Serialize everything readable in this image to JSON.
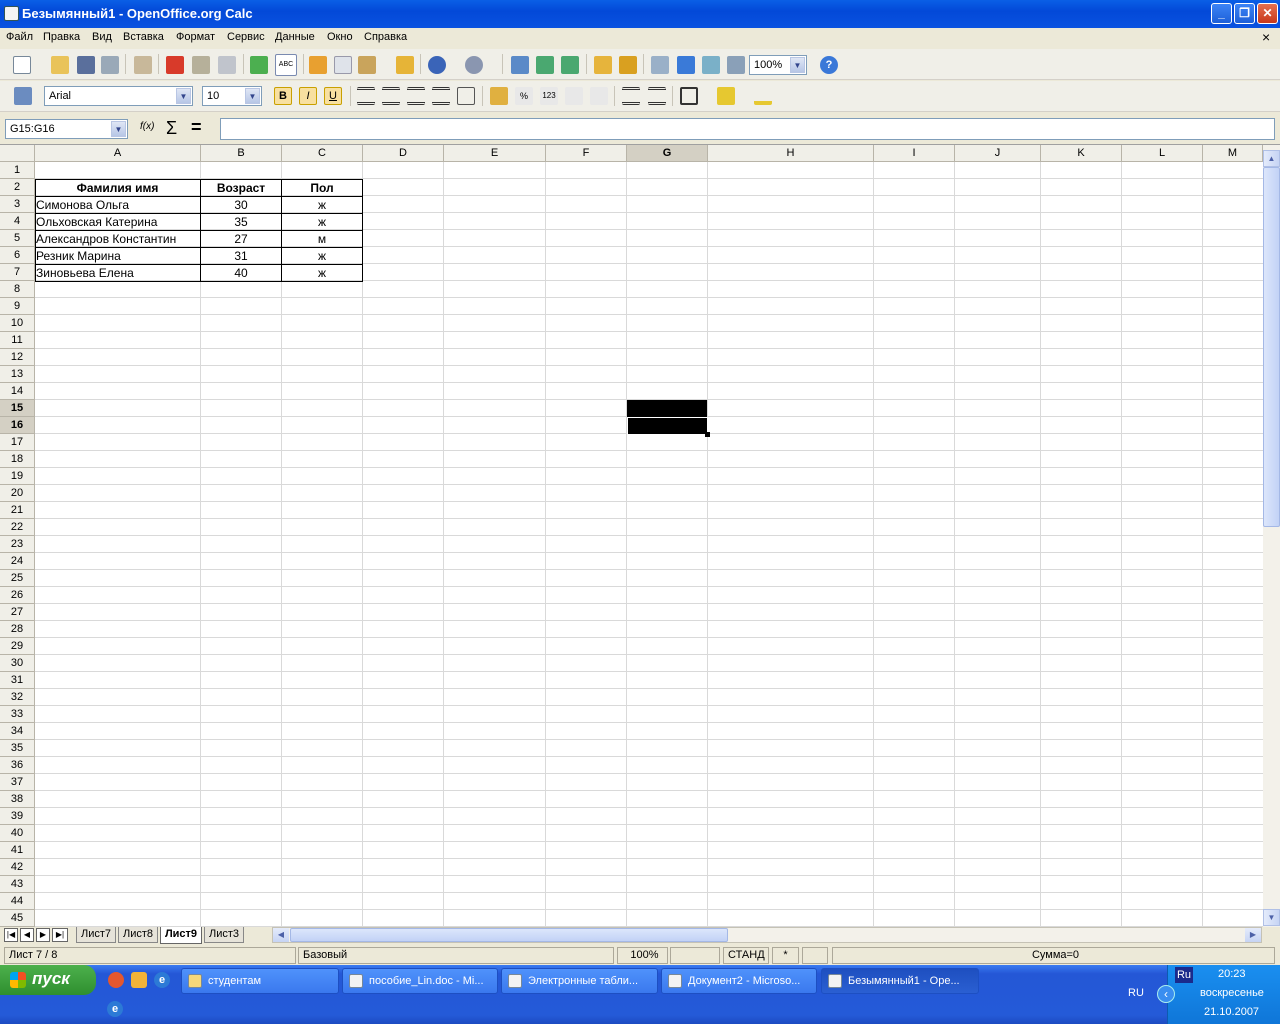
{
  "window": {
    "title": "Безымянный1 - OpenOffice.org Calc"
  },
  "menu": [
    "Файл",
    "Правка",
    "Вид",
    "Вставка",
    "Формат",
    "Сервис",
    "Данные",
    "Окно",
    "Справка"
  ],
  "toolbar": {
    "zoom": "100%"
  },
  "format_bar": {
    "font_name": "Arial",
    "font_size": "10",
    "bold": "B",
    "italic": "I",
    "underline": "U"
  },
  "formula_bar": {
    "name_box": "G15:G16",
    "formula": ""
  },
  "columns": [
    "A",
    "B",
    "C",
    "D",
    "E",
    "F",
    "G",
    "H",
    "I",
    "J",
    "K",
    "L",
    "M"
  ],
  "selected_column": "G",
  "rows": [
    "1",
    "2",
    "3",
    "4",
    "5",
    "6",
    "7",
    "8",
    "9",
    "10",
    "11",
    "12",
    "13",
    "14",
    "15",
    "16",
    "17",
    "18",
    "19",
    "20",
    "21",
    "22",
    "23",
    "24",
    "25",
    "26",
    "27",
    "28",
    "29",
    "30",
    "31",
    "32",
    "33",
    "34",
    "35",
    "36",
    "37",
    "38",
    "39",
    "40",
    "41",
    "42",
    "43",
    "44",
    "45"
  ],
  "selected_rows": [
    "15",
    "16"
  ],
  "table": {
    "headers": [
      "Фамилия имя",
      "Возраст",
      "Пол"
    ],
    "rows": [
      [
        "Симонова Ольга",
        "30",
        "ж"
      ],
      [
        "Ольховская Катерина",
        "35",
        "ж"
      ],
      [
        "Александров Константин",
        "27",
        "м"
      ],
      [
        "Резник Марина",
        "31",
        "ж"
      ],
      [
        "Зиновьева Елена",
        "40",
        "ж"
      ]
    ]
  },
  "sheets": [
    "Лист7",
    "Лист8",
    "Лист9",
    "Лист3"
  ],
  "active_sheet": "Лист9",
  "status": {
    "sheet": "Лист 7 / 8",
    "style": "Базовый",
    "zoom": "100%",
    "mode": "СТАНД",
    "modified": "*",
    "sum": "Сумма=0"
  },
  "taskbar": {
    "start": "пуск",
    "tasks": [
      "студентам",
      "пособие_Lin.doc - Mi...",
      "Электронные табли...",
      "Документ2 - Microso...",
      "Безымянный1 - Ope..."
    ],
    "lang": "RU",
    "lang_badge": "Ru",
    "time": "20:23",
    "day": "воскресенье",
    "date": "21.10.2007"
  }
}
